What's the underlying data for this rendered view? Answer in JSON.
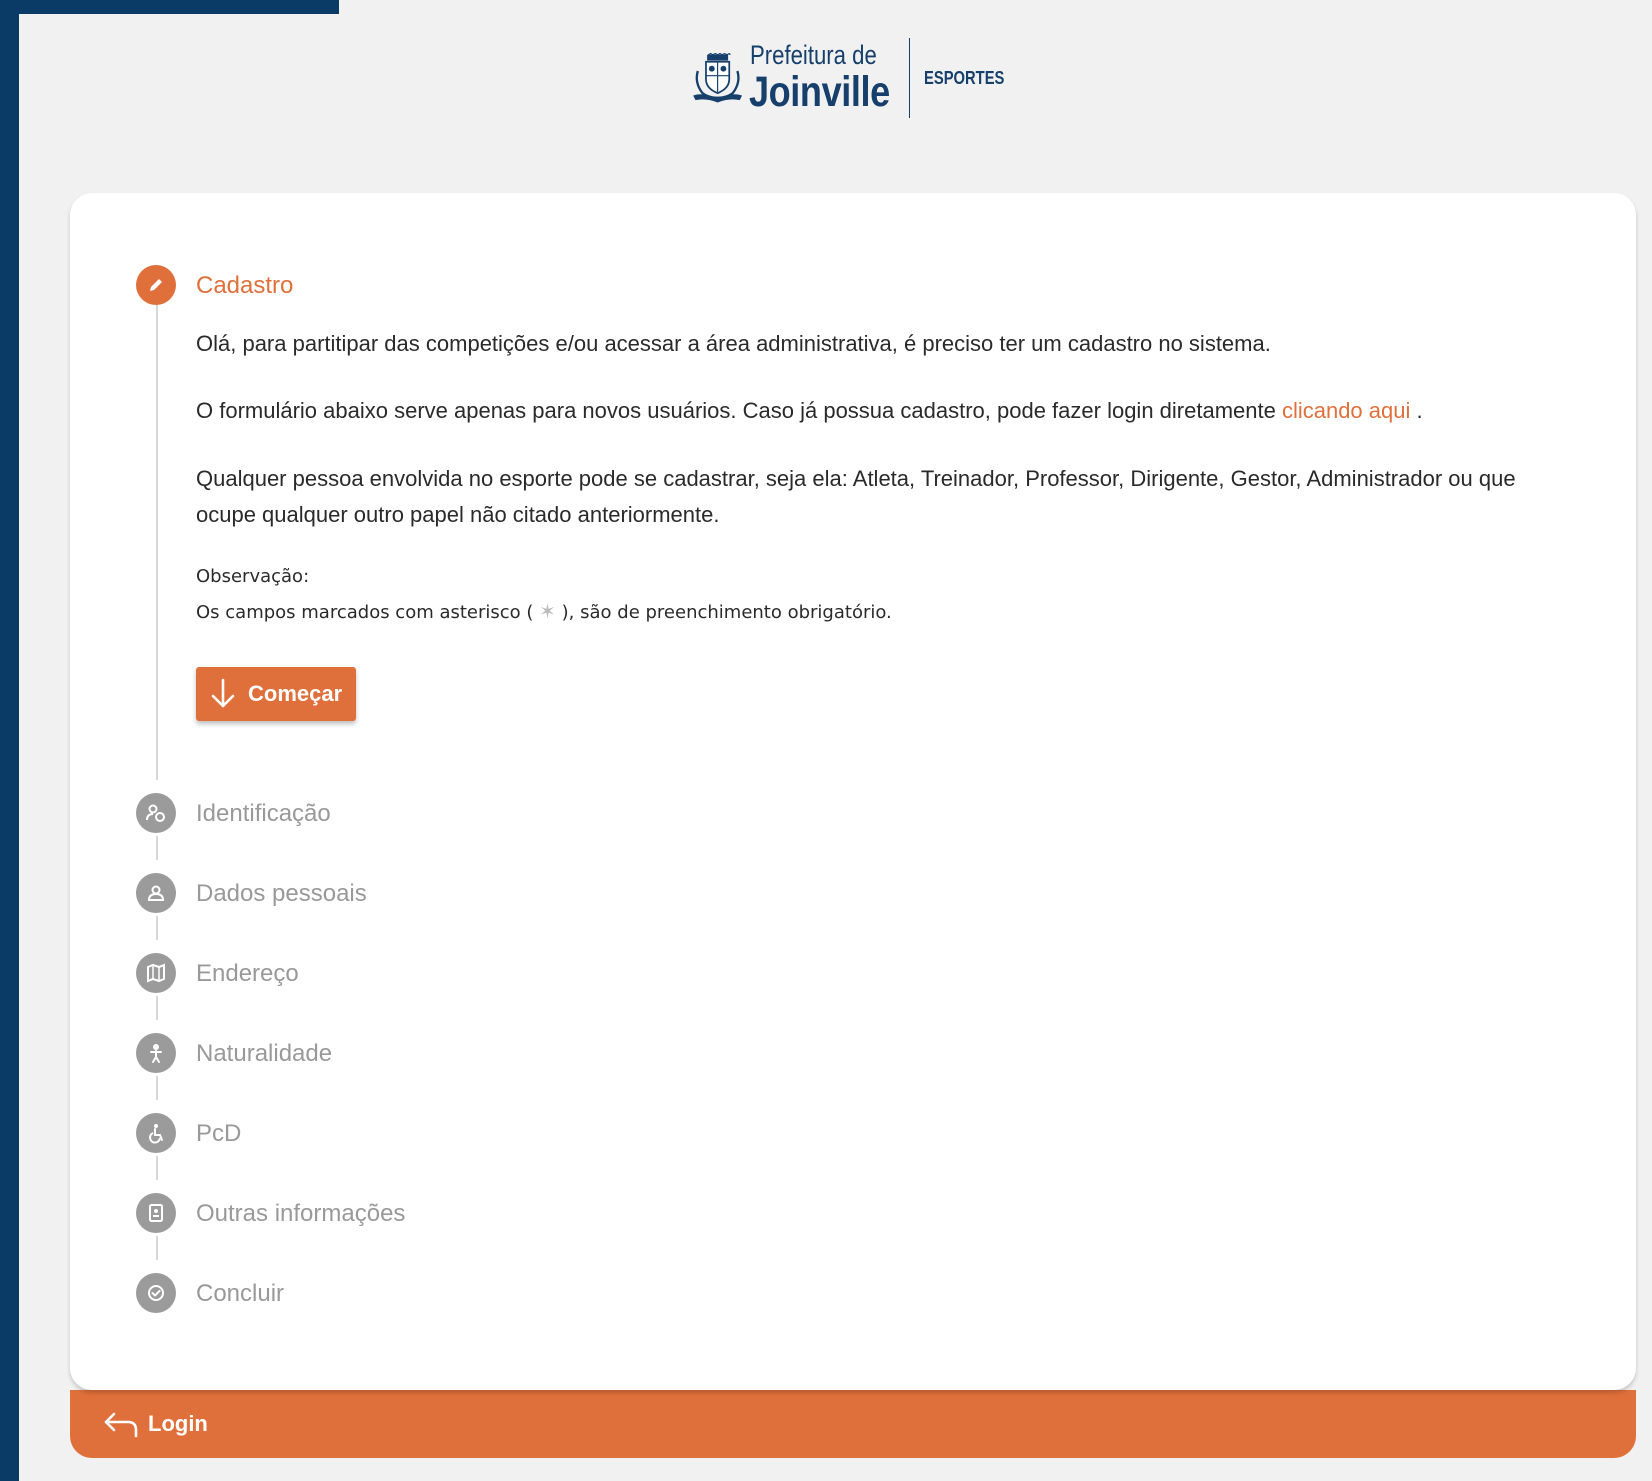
{
  "header": {
    "brand_small": "Prefeitura de",
    "brand_big": "Joinville",
    "brand_sub": "ESPORTES"
  },
  "stepper": {
    "active_step": {
      "title": "Cadastro",
      "intro": "Olá, para partitipar das competições e/ou acessar a área administrativa, é preciso ter um cadastro no sistema.",
      "form_info_before": "O formulário abaixo serve apenas para novos usuários. Caso já possua cadastro, pode fazer login diretamente ",
      "form_info_link": "clicando aqui",
      "form_info_after": " .",
      "who_can": "Qualquer pessoa envolvida no esporte pode se cadastrar, seja ela: Atleta, Treinador, Professor, Dirigente, Gestor, Administrador ou que ocupe qualquer outro papel não citado anteriormente.",
      "obs_label": "Observação:",
      "obs_before": "Os campos marcados com asterisco ( ",
      "obs_star": "✶",
      "obs_after": " ), são de preenchimento obrigatório.",
      "start_button": "Começar"
    },
    "steps": [
      {
        "title": "Identificação",
        "icon": "person-badge-icon"
      },
      {
        "title": "Dados pessoais",
        "icon": "person-icon"
      },
      {
        "title": "Endereço",
        "icon": "map-icon"
      },
      {
        "title": "Naturalidade",
        "icon": "baby-icon"
      },
      {
        "title": "PcD",
        "icon": "wheelchair-icon"
      },
      {
        "title": "Outras informações",
        "icon": "contact-card-icon"
      },
      {
        "title": "Concluir",
        "icon": "check-circle-icon"
      }
    ]
  },
  "footer": {
    "login_label": "Login"
  },
  "colors": {
    "accent": "#e0703b",
    "navy": "#0a3a66",
    "inactive": "#9b9b9b"
  }
}
